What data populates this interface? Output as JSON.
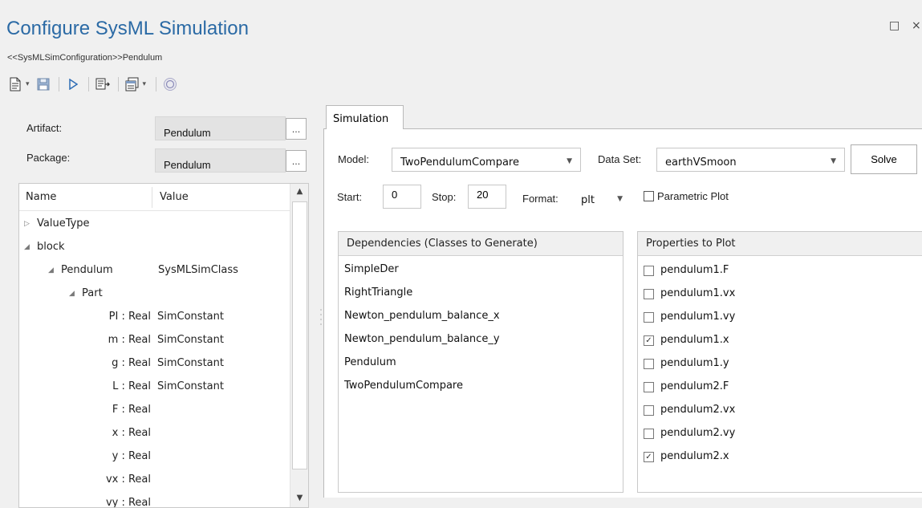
{
  "window": {
    "title": "Configure SysML Simulation",
    "subtitle": "<<SysMLSimConfiguration>>Pendulum",
    "restore_glyph": "□",
    "close_glyph": "×"
  },
  "toolbar": {
    "icons": [
      "new-document-icon",
      "save-icon",
      "run-icon",
      "generate-code-icon",
      "export-icon",
      "help-icon"
    ]
  },
  "left": {
    "artifact_label": "Artifact:",
    "artifact_value": "Pendulum",
    "package_label": "Package:",
    "package_value": "Pendulum",
    "ellipsis": "...",
    "tree": {
      "col_name": "Name",
      "col_value": "Value",
      "rows": [
        {
          "name": "ValueType",
          "value": ""
        },
        {
          "name": "block",
          "value": ""
        },
        {
          "name": "Pendulum",
          "value": "SysMLSimClass"
        },
        {
          "name": "Part",
          "value": ""
        },
        {
          "name": "PI : Real",
          "value": "SimConstant"
        },
        {
          "name": "m : Real",
          "value": "SimConstant"
        },
        {
          "name": "g : Real",
          "value": "SimConstant"
        },
        {
          "name": "L : Real",
          "value": "SimConstant"
        },
        {
          "name": "F : Real",
          "value": ""
        },
        {
          "name": "x : Real",
          "value": ""
        },
        {
          "name": "y : Real",
          "value": ""
        },
        {
          "name": "vx : Real",
          "value": ""
        },
        {
          "name": "vy : Real",
          "value": ""
        }
      ]
    }
  },
  "simulation": {
    "tab_label": "Simulation",
    "model_label": "Model:",
    "model_value": "TwoPendulumCompare",
    "dataset_label": "Data Set:",
    "dataset_value": "earthVSmoon",
    "solve_label": "Solve",
    "start_label": "Start:",
    "start_value": "0",
    "stop_label": "Stop:",
    "stop_value": "20",
    "format_label": "Format:",
    "format_value": "plt",
    "parametric_label": "Parametric Plot",
    "parametric_checked": false,
    "dependencies_header": "Dependencies (Classes to Generate)",
    "dependencies": [
      "SimpleDer",
      "RightTriangle",
      "Newton_pendulum_balance_x",
      "Newton_pendulum_balance_y",
      "Pendulum",
      "TwoPendulumCompare"
    ],
    "properties_header": "Properties to Plot",
    "properties": [
      {
        "label": "pendulum1.F",
        "checked": false
      },
      {
        "label": "pendulum1.vx",
        "checked": false
      },
      {
        "label": "pendulum1.vy",
        "checked": false
      },
      {
        "label": "pendulum1.x",
        "checked": true
      },
      {
        "label": "pendulum1.y",
        "checked": false
      },
      {
        "label": "pendulum2.F",
        "checked": false
      },
      {
        "label": "pendulum2.vx",
        "checked": false
      },
      {
        "label": "pendulum2.vy",
        "checked": false
      },
      {
        "label": "pendulum2.x",
        "checked": true
      }
    ]
  }
}
